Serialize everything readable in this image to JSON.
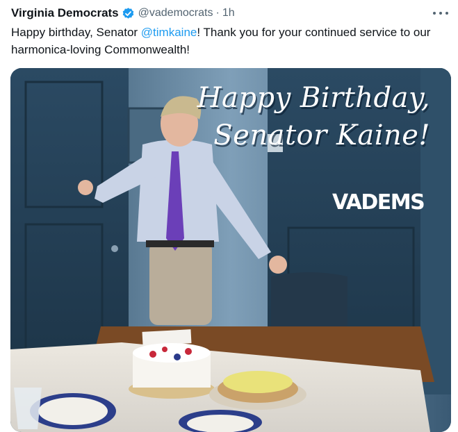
{
  "tweet": {
    "author_name": "Virginia Democrats",
    "handle": "@vademocrats",
    "separator": "·",
    "time": "1h",
    "text_before": "Happy birthday, Senator ",
    "mention": "@timkaine",
    "text_after": "! Thank you for your continued service to our harmonica-loving Commonwealth!"
  },
  "media": {
    "title_line1": "Happy Birthday,",
    "title_line2": "Senator Kaine!",
    "logo_text": "VADEMS"
  },
  "colors": {
    "link": "#1d9bf0",
    "verified": "#1d9bf0",
    "secondary_text": "#536471"
  },
  "icons": [
    "verified-badge-icon",
    "more-options-icon"
  ]
}
